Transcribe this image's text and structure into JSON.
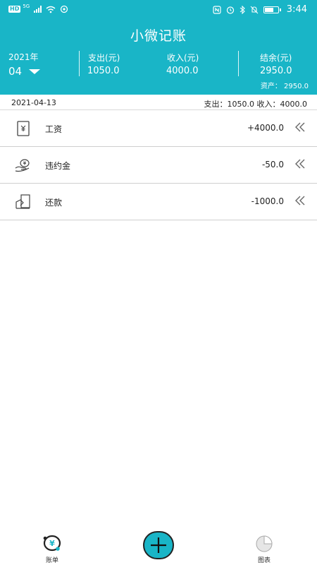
{
  "status_bar": {
    "network_badge": "HD",
    "network_type": "5G",
    "time": "3:44"
  },
  "app": {
    "title": "小微记账"
  },
  "summary": {
    "year": "2021年",
    "month": "04",
    "expense_label": "支出(元)",
    "expense_value": "1050.0",
    "income_label": "收入(元)",
    "income_value": "4000.0",
    "balance_label": "结余(元)",
    "balance_value": "2950.0",
    "assets": "资产： 2950.0"
  },
  "day_group": {
    "date": "2021-04-13",
    "totals": "支出：1050.0 收入：4000.0"
  },
  "records": [
    {
      "name": "工资",
      "amount": "+4000.0",
      "icon": "salary-icon"
    },
    {
      "name": "违约金",
      "amount": "-50.0",
      "icon": "penalty-icon"
    },
    {
      "name": "还款",
      "amount": "-1000.0",
      "icon": "repayment-icon"
    }
  ],
  "tabs": {
    "bills_label": "账单",
    "charts_label": "图表"
  },
  "colors": {
    "accent": "#19b5c7"
  }
}
